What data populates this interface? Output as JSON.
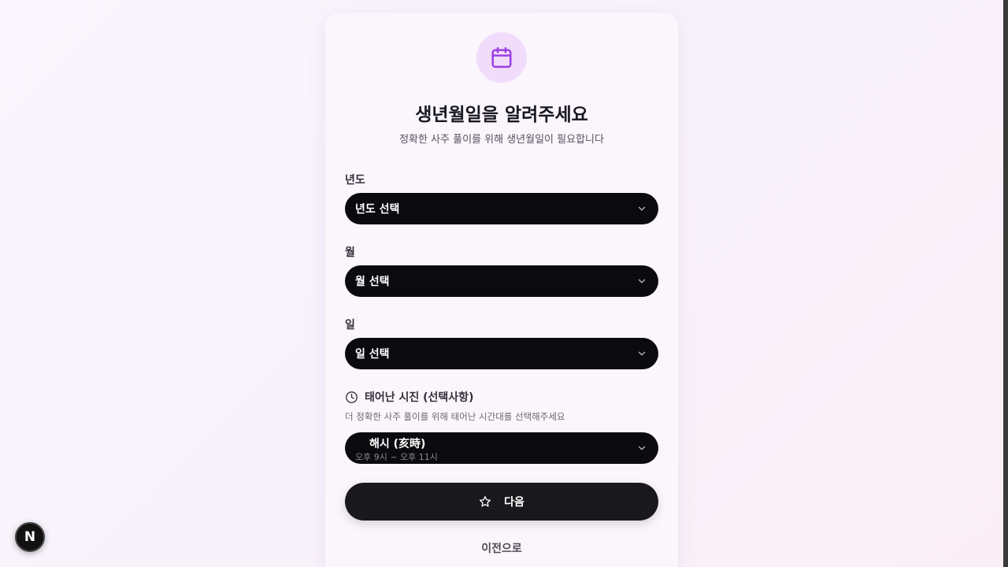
{
  "header": {
    "icon": "calendar-icon",
    "title": "생년월일을 알려주세요",
    "subtitle": "정확한 사주 풀이를 위해 생년월일이 필요합니다"
  },
  "year": {
    "label": "년도",
    "placeholder": "년도 선택"
  },
  "month": {
    "label": "월",
    "placeholder": "월 선택"
  },
  "day": {
    "label": "일",
    "placeholder": "일 선택"
  },
  "birth_time": {
    "label": "태어난 시진 (선택사항)",
    "hint": "더 정확한 사주 풀이를 위해 태어난 시간대를 선택해주세요",
    "selected_name": "해시 (亥時)",
    "selected_range": "오후 9시 ~ 오후 11시"
  },
  "actions": {
    "next_label": "다음",
    "back_label": "이전으로"
  },
  "dev_badge": "N",
  "colors": {
    "accent": "#9b3fe0",
    "select_bg": "#0b0a0e",
    "button_bg": "#19181c"
  }
}
